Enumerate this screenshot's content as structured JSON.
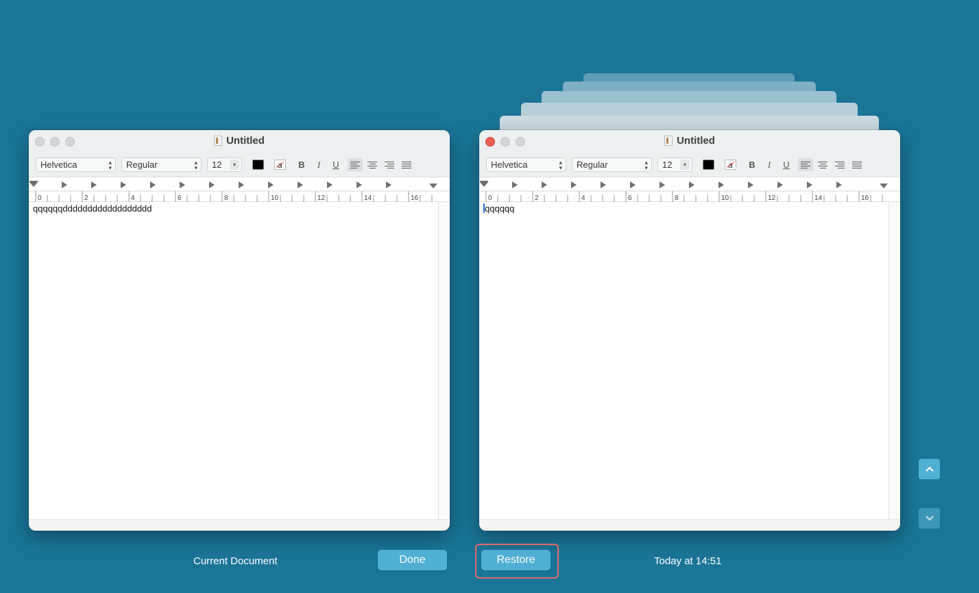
{
  "left_window": {
    "title": "Untitled",
    "font": "Helvetica",
    "style": "Regular",
    "size": "12",
    "body_text": "qqqqqqdddddddddddddddddd"
  },
  "right_window": {
    "title": "Untitled",
    "font": "Helvetica",
    "style": "Regular",
    "size": "12",
    "body_text": "qqqqqq"
  },
  "ruler_labels": [
    "0",
    "2",
    "4",
    "6",
    "8",
    "10",
    "12",
    "14",
    "16"
  ],
  "format_buttons": {
    "bold": "B",
    "italic": "I",
    "underline": "U"
  },
  "bg_color_glyph": "a",
  "footer": {
    "current_label": "Current Document",
    "done_label": "Done",
    "restore_label": "Restore",
    "version_label": "Today at 14:51"
  },
  "colors": {
    "background": "#1a7597",
    "button": "#4fb0d3",
    "highlight_ring": "#e26a6a",
    "close_red": "#ee5f57"
  }
}
